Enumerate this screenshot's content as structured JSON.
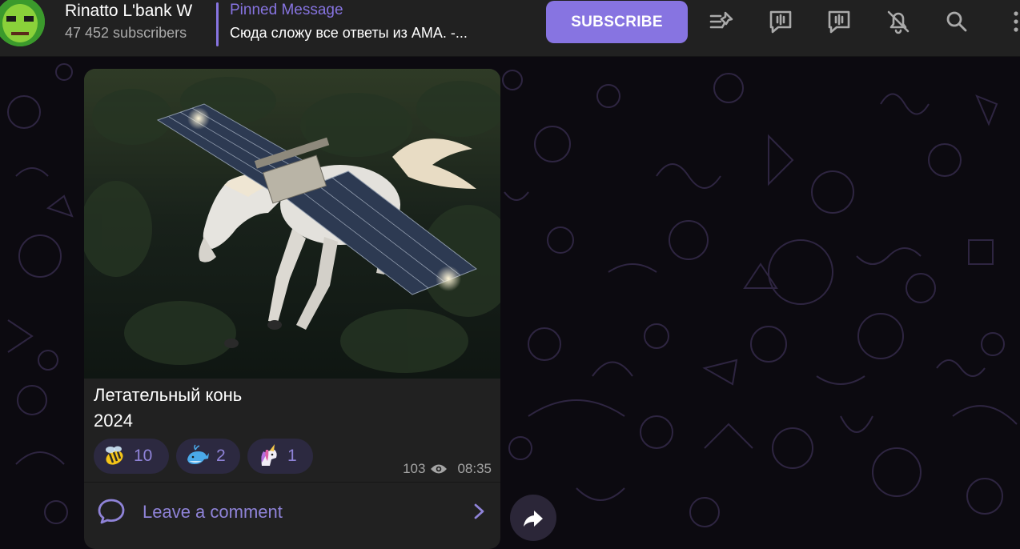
{
  "header": {
    "channel_title": "Rinatto L'bank W",
    "subscribers": "47 452 subscribers",
    "pinned_title": "Pinned Message",
    "pinned_text": "Сюда сложу все ответы из AMA. -...",
    "subscribe_label": "SUBSCRIBE",
    "icons": [
      "pinned-list-icon",
      "live-stream-icon",
      "discussion-icon",
      "mute-bell-icon",
      "search-icon",
      "more-icon"
    ]
  },
  "message": {
    "image_alt": "white winged horse with satellite solar panels flying over a forest",
    "caption_line1": "Летательный конь",
    "caption_line2": "2024",
    "reactions": [
      {
        "emoji": "bee-emoji-icon",
        "count": "10"
      },
      {
        "emoji": "whale-emoji-icon",
        "count": "2"
      },
      {
        "emoji": "unicorn-emoji-icon",
        "count": "1"
      }
    ],
    "views": "103",
    "time": "08:35",
    "comment_label": "Leave a comment"
  },
  "colors": {
    "accent": "#8774e1",
    "header_bg": "#212121",
    "bubble_bg": "#212121",
    "background": "#0c0a10"
  }
}
